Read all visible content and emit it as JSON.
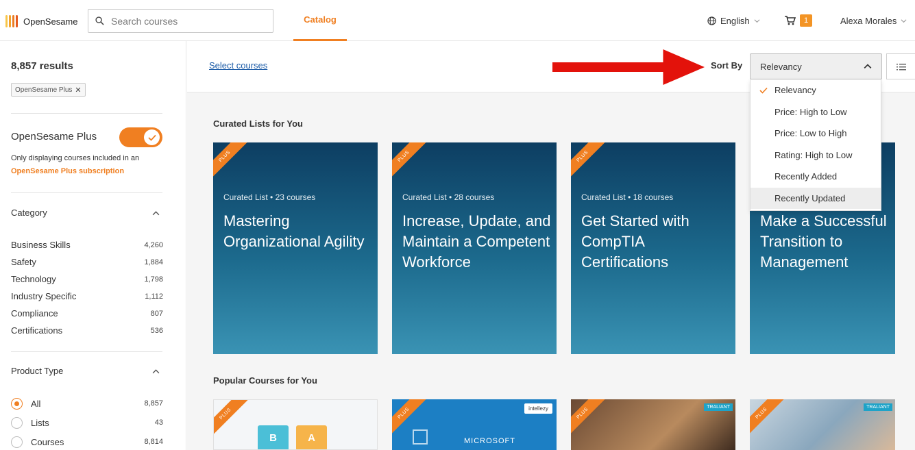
{
  "header": {
    "logo_text": "OpenSesame",
    "search_placeholder": "Search courses",
    "nav_tab": "Catalog",
    "language": "English",
    "cart_count": "1",
    "user_name": "Alexa Morales"
  },
  "sidebar": {
    "results": "8,857 results",
    "active_filter": "OpenSesame Plus",
    "plus_title": "OpenSesame Plus",
    "plus_toggle_on": true,
    "plus_desc": "Only displaying courses included in an",
    "plus_link": "OpenSesame Plus subscription",
    "category_title": "Category",
    "categories": [
      {
        "label": "Business Skills",
        "count": "4,260"
      },
      {
        "label": "Safety",
        "count": "1,884"
      },
      {
        "label": "Technology",
        "count": "1,798"
      },
      {
        "label": "Industry Specific",
        "count": "1,112"
      },
      {
        "label": "Compliance",
        "count": "807"
      },
      {
        "label": "Certifications",
        "count": "536"
      }
    ],
    "product_type_title": "Product Type",
    "product_types": [
      {
        "label": "All",
        "count": "8,857",
        "selected": true
      },
      {
        "label": "Lists",
        "count": "43",
        "selected": false
      },
      {
        "label": "Courses",
        "count": "8,814",
        "selected": false
      }
    ]
  },
  "toolbar": {
    "select_courses": "Select courses",
    "sort_label": "Sort By",
    "sort_value": "Relevancy"
  },
  "sort_options": [
    {
      "label": "Relevancy",
      "checked": true
    },
    {
      "label": "Price: High to Low",
      "checked": false
    },
    {
      "label": "Price: Low to High",
      "checked": false
    },
    {
      "label": "Rating: High to Low",
      "checked": false
    },
    {
      "label": "Recently Added",
      "checked": false
    },
    {
      "label": "Recently Updated",
      "checked": false,
      "hovered": true
    }
  ],
  "curated": {
    "heading": "Curated Lists for You",
    "ribbon": "PLUS",
    "cards": [
      {
        "meta": "Curated List • 23 courses",
        "title": "Mastering Organizational Agility"
      },
      {
        "meta": "Curated List • 28 courses",
        "title": "Increase, Update, and Maintain a Competent Workforce"
      },
      {
        "meta": "Curated List • 18 courses",
        "title": "Get Started with CompTIA Certifications"
      },
      {
        "meta": "",
        "title": "Make a Successful Transition to Management"
      }
    ]
  },
  "popular": {
    "heading": "Popular Courses for You",
    "brands": [
      "intellezy",
      "TRALIANT",
      "TRALIANT"
    ],
    "thumb_text": [
      "B",
      "A",
      "MICROSOFT"
    ]
  },
  "colors": {
    "accent": "#f07f21",
    "link": "#1a5aa6",
    "card_top": "#0d3e62",
    "card_bottom": "#3a93b4",
    "arrow": "#e3120b"
  }
}
